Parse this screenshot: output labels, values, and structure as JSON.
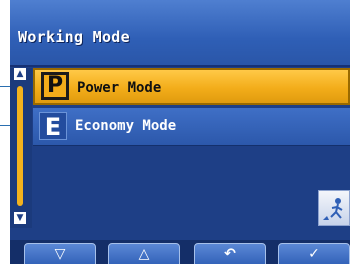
{
  "window": {
    "title": "Working Mode"
  },
  "modes": [
    {
      "letter": "P",
      "label": "Power Mode",
      "selected": true
    },
    {
      "letter": "E",
      "label": "Economy Mode",
      "selected": false
    }
  ],
  "scrollbar": {
    "up_glyph": "▲",
    "down_glyph": "▼"
  },
  "side_icon": {
    "name": "mode-figure-icon"
  },
  "softkeys": {
    "down": "▽",
    "up": "△",
    "back": "↶",
    "confirm": "✓"
  },
  "colors": {
    "screen_bg": "#1e3f86",
    "selected_row": "#f3ad1a",
    "text_light": "#ffffff",
    "text_dark": "#111111"
  }
}
